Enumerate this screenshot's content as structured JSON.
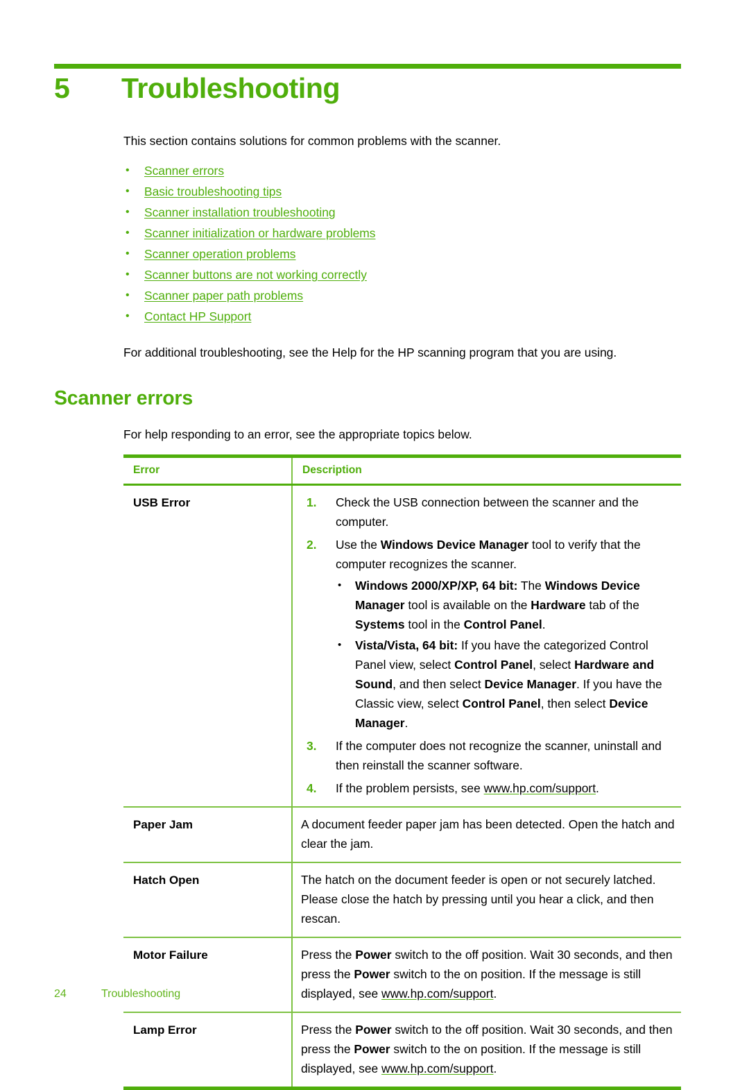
{
  "theme": {
    "accent_green": "#4FAE0B",
    "rule_green": "#7DC242",
    "footer_green": "#61B41C",
    "text_black": "#000000"
  },
  "chapter": {
    "number": "5",
    "title": "Troubleshooting"
  },
  "intro": {
    "paragraph": "This section contains solutions for common problems with the scanner.",
    "links": [
      "Scanner errors",
      "Basic troubleshooting tips",
      "Scanner installation troubleshooting",
      "Scanner initialization or hardware problems",
      "Scanner operation problems",
      "Scanner buttons are not working correctly",
      "Scanner paper path problems",
      "Contact HP Support"
    ],
    "paragraph2": "For additional troubleshooting, see the Help for the HP scanning program that you are using."
  },
  "section": {
    "heading": "Scanner errors",
    "lead": "For help responding to an error, see the appropriate topics below."
  },
  "table": {
    "headers": {
      "error": "Error",
      "description": "Description"
    },
    "rows": {
      "usb_error": {
        "error": "USB Error",
        "steps": [
          {
            "text_before": "Check the USB connection between the scanner and the computer."
          },
          {
            "text_before": "Use the ",
            "bold1": "Windows Device Manager",
            "text_mid": " tool to verify that the computer recognizes the scanner.",
            "substeps": [
              {
                "lead_bold": "Windows 2000/XP/XP, 64 bit:",
                "plain1": " The ",
                "b1": "Windows Device Manager",
                "plain2": " tool is available on the ",
                "b2": "Hardware",
                "plain3": " tab of the ",
                "b3": "Systems",
                "plain4": " tool in the ",
                "b4": "Control Panel",
                "plain5": "."
              },
              {
                "lead_bold": "Vista/Vista, 64 bit:",
                "plain1": " If you have the categorized Control Panel view, select ",
                "b1": "Control Panel",
                "plain2": ", select ",
                "b2": "Hardware and Sound",
                "plain3": ", and then select ",
                "b3": "Device Manager",
                "plain4": ". If you have the Classic view, select ",
                "b4": "Control Panel",
                "plain5": ", then select ",
                "b5": "Device Manager",
                "plain6": "."
              }
            ]
          },
          {
            "text_before": "If the computer does not recognize the scanner, uninstall and then reinstall the scanner software."
          },
          {
            "text_before": "If the problem persists, see ",
            "link": "www.hp.com/support",
            "text_after": "."
          }
        ]
      },
      "paper_jam": {
        "error": "Paper Jam",
        "description": "A document feeder paper jam has been detected. Open the hatch and clear the jam."
      },
      "hatch_open": {
        "error": "Hatch Open",
        "description": "The hatch on the document feeder is open or not securely latched. Please close the hatch by pressing until you hear a click, and then rescan."
      },
      "motor_failure": {
        "error": "Motor Failure",
        "p1": "Press the ",
        "b1": "Power",
        "p2": " switch to the off position. Wait 30 seconds, and then press the ",
        "b2": "Power",
        "p3": " switch to the on position. If the message is still displayed, see ",
        "link": "www.hp.com/support",
        "p4": "."
      },
      "lamp_error": {
        "error": "Lamp Error",
        "p1": "Press the ",
        "b1": "Power",
        "p2": " switch to the off position. Wait 30 seconds, and then press the ",
        "b2": "Power",
        "p3": " switch to the on position. If the message is still displayed, see ",
        "link": "www.hp.com/support",
        "p4": "."
      }
    }
  },
  "footer": {
    "page_number": "24",
    "chapter_label": "Troubleshooting"
  }
}
